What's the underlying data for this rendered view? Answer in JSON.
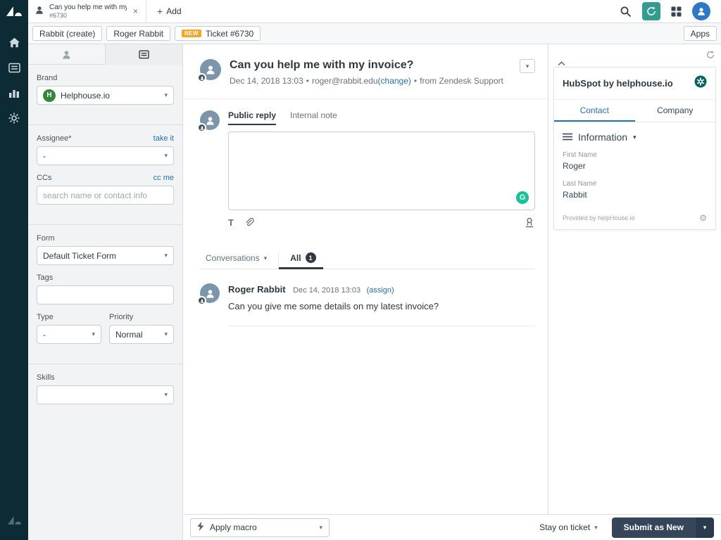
{
  "topbar": {
    "tab_title": "Can you help me with my ...",
    "tab_subtitle": "#6730",
    "add_label": "Add"
  },
  "breadcrumbs": {
    "items": [
      {
        "label": "Rabbit (create)"
      },
      {
        "label": "Roger Rabbit"
      },
      {
        "label": "Ticket #6730",
        "badge": "NEW"
      }
    ],
    "apps_label": "Apps"
  },
  "ticket_fields": {
    "brand": {
      "label": "Brand",
      "value": "Helphouse.io"
    },
    "assignee": {
      "label": "Assignee*",
      "action": "take it",
      "value": "-"
    },
    "ccs": {
      "label": "CCs",
      "action": "cc me",
      "placeholder": "search name or contact info"
    },
    "form": {
      "label": "Form",
      "value": "Default Ticket Form"
    },
    "tags": {
      "label": "Tags"
    },
    "type": {
      "label": "Type",
      "value": "-"
    },
    "priority": {
      "label": "Priority",
      "value": "Normal"
    },
    "skills": {
      "label": "Skills"
    }
  },
  "ticket": {
    "title": "Can you help me with my invoice?",
    "meta": {
      "date": "Dec 14, 2018 13:03",
      "separator": "•",
      "email": "roger@rabbit.edu",
      "change_link": "(change)",
      "source": "from Zendesk Support"
    },
    "composer": {
      "tab_public": "Public reply",
      "tab_internal": "Internal note"
    },
    "conversations": {
      "label": "Conversations",
      "all_label": "All",
      "all_count": "1"
    },
    "messages": [
      {
        "author": "Roger Rabbit",
        "date": "Dec 14, 2018 13:03",
        "assign_link": "(assign)",
        "text": "Can you give me some details on my latest invoice?"
      }
    ]
  },
  "footer": {
    "apply_macro": "Apply macro",
    "stay_on_ticket": "Stay on ticket",
    "submit_label": "Submit as New"
  },
  "hubspot": {
    "title": "HubSpot by helphouse.io",
    "tab_contact": "Contact",
    "tab_company": "Company",
    "section_title": "Information",
    "fields": [
      {
        "label": "First Name",
        "value": "Roger"
      },
      {
        "label": "Last Name",
        "value": "Rabbit"
      }
    ],
    "provided_by": "Provided by helpHouse.io"
  },
  "icons": {
    "text_format": "T",
    "grammarly": "G",
    "brand_initial": "H"
  },
  "colors": {
    "nav_bg": "#0c2b35",
    "accent_blue": "#1f73b7",
    "new_badge": "#f5a623",
    "submit_button": "#36465a",
    "sync_teal": "#2f9e8e",
    "grammarly_green": "#15c39a",
    "hubspot_teal": "#07635d"
  }
}
